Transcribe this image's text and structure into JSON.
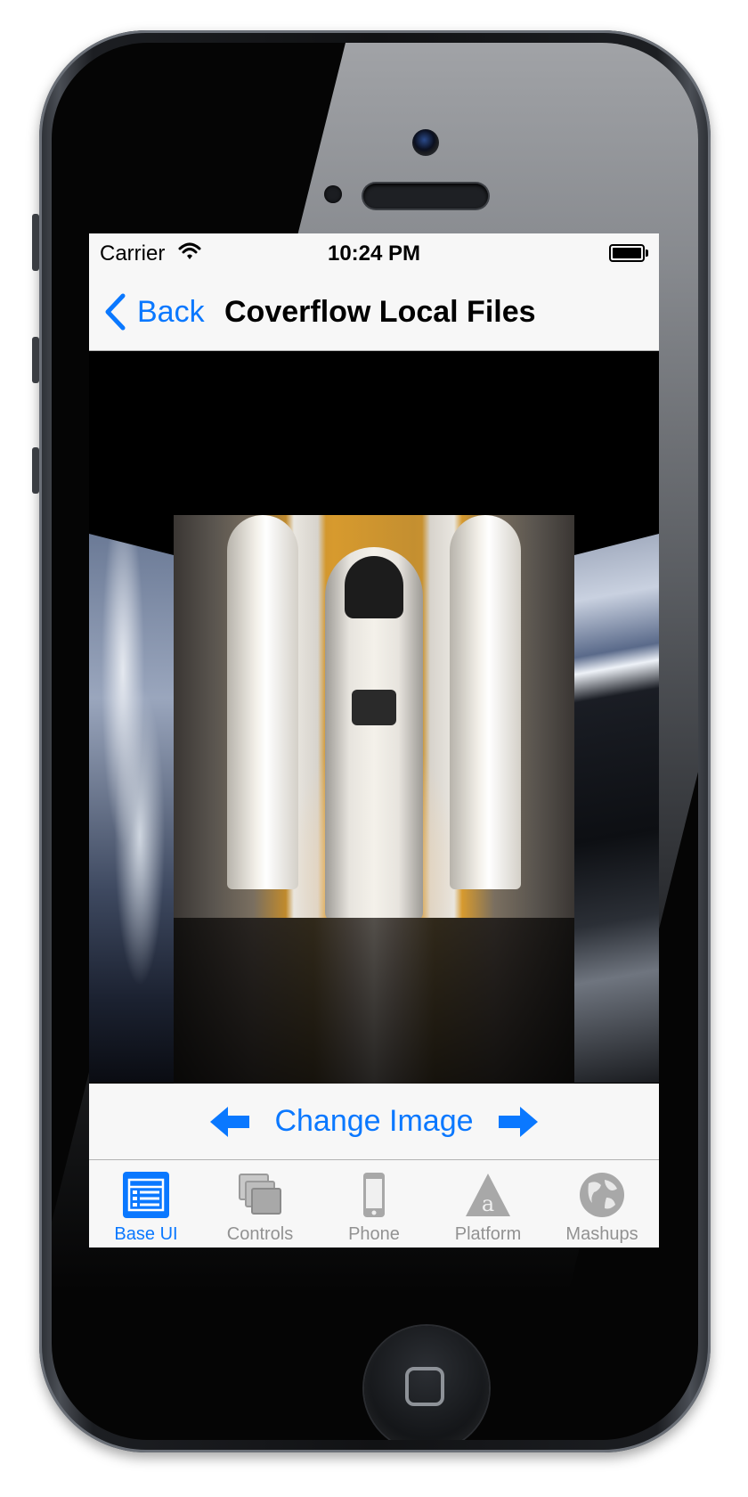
{
  "status_bar": {
    "carrier": "Carrier",
    "time": "10:24 PM",
    "wifi_icon": "wifi-icon",
    "battery_icon": "battery-icon"
  },
  "nav_bar": {
    "back_label": "Back",
    "back_icon": "chevron-left-icon",
    "title": "Coverflow Local Files"
  },
  "coverflow": {
    "images": [
      {
        "name": "earth-image",
        "position": "left"
      },
      {
        "name": "space-shuttle-image",
        "position": "center",
        "selected": true
      },
      {
        "name": "space-station-image",
        "position": "right"
      }
    ]
  },
  "toolbar": {
    "prev_icon": "arrow-left-icon",
    "label": "Change Image",
    "next_icon": "arrow-right-icon"
  },
  "tab_bar": {
    "active_index": 0,
    "tabs": [
      {
        "label": "Base UI",
        "icon": "list-icon"
      },
      {
        "label": "Controls",
        "icon": "windows-icon"
      },
      {
        "label": "Phone",
        "icon": "phone-icon"
      },
      {
        "label": "Platform",
        "icon": "platform-icon"
      },
      {
        "label": "Mashups",
        "icon": "globe-icon"
      }
    ]
  },
  "colors": {
    "accent": "#0a78ff",
    "inactive": "#929292",
    "bar_background": "#f7f7f7"
  }
}
